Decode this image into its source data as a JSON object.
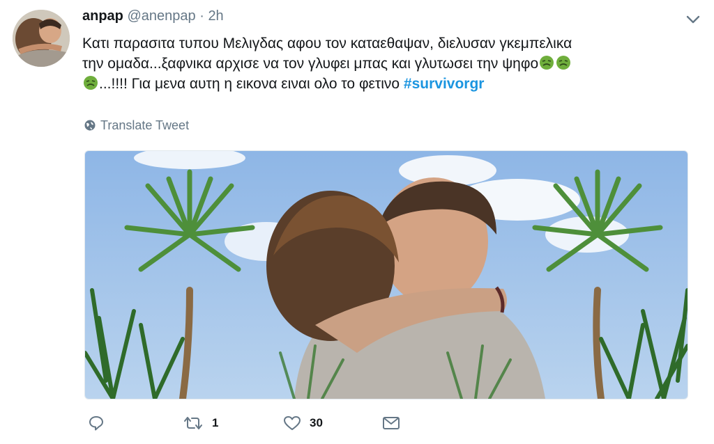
{
  "tweet": {
    "display_name": "anpap",
    "handle": "@anenpap",
    "separator": "·",
    "time": "2h",
    "text_line1": "Κατι παρασιτα τυπου Μελιγδας αφου τον καταεθαψαν, διελυσαν γκεμπελικα",
    "text_line2": "την ομαδα...ξαφνικα αρχισε να τον γλυφει μπας και γλυτωσει την ψηφο",
    "text_line3": "...!!!! Για μενα αυτη η εικονα ειναι ολο το φετινο",
    "hashtag": "#survivorgr",
    "translate_label": "Translate Tweet"
  },
  "actions": {
    "reply_count": "",
    "retweet_count": "1",
    "like_count": "30"
  },
  "icons": {
    "caret": "chevron-down-icon",
    "globe": "globe-icon",
    "reply": "reply-icon",
    "retweet": "retweet-icon",
    "like": "heart-icon",
    "dm": "envelope-icon",
    "emoji": "nauseated-face-emoji"
  },
  "colors": {
    "text": "#14171a",
    "secondary": "#657786",
    "hashtag": "#1b95e0",
    "emoji": "#6fae3c"
  }
}
